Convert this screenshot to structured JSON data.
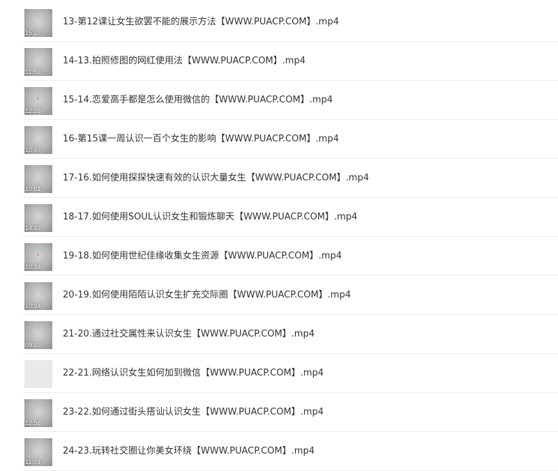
{
  "files": [
    {
      "name": "13-第12课让女生欲罢不能的展示方法【WWW.PUACP.COM】.mp4",
      "duration": "15:27",
      "thumb": "gray"
    },
    {
      "name": "14-13.拍照修图的网红使用法【WWW.PUACP.COM】.mp4",
      "duration": "11:50",
      "thumb": "gray"
    },
    {
      "name": "15-14.恋爱高手都是怎么使用微信的【WWW.PUACP.COM】.mp4",
      "duration": "12:16",
      "thumb": "gray-dot"
    },
    {
      "name": "16-第15课一周认识一百个女生的影响【WWW.PUACP.COM】.mp4",
      "duration": "10:47",
      "thumb": "gray"
    },
    {
      "name": "17-16.如何使用探探快速有效的认识大量女生【WWW.PUACP.COM】.mp4",
      "duration": "10:01",
      "thumb": "gray"
    },
    {
      "name": "18-17.如何使用SOUL认识女生和锻炼聊天【WWW.PUACP.COM】.mp4",
      "duration": "14:27",
      "thumb": "gray"
    },
    {
      "name": "19-18.如何使用世纪佳缘收集女生资源【WWW.PUACP.COM】.mp4",
      "duration": "10:34",
      "thumb": "gray-dot"
    },
    {
      "name": "20-19.如何使用陌陌认识女生扩充交际圈【WWW.PUACP.COM】.mp4",
      "duration": "10:34",
      "thumb": "gray"
    },
    {
      "name": "21-20.通过社交属性来认识女生【WWW.PUACP.COM】.mp4",
      "duration": "09:49",
      "thumb": "gray"
    },
    {
      "name": "22-21.网络认识女生如何加到微信【WWW.PUACP.COM】.mp4",
      "duration": "",
      "thumb": "blank"
    },
    {
      "name": "23-22.如何通过街头搭讪认识女生【WWW.PUACP.COM】.mp4",
      "duration": "12:58",
      "thumb": "gray"
    },
    {
      "name": "24-23.玩转社交圈让你美女环绕【WWW.PUACP.COM】.mp4",
      "duration": "11:04",
      "thumb": "gray"
    }
  ]
}
